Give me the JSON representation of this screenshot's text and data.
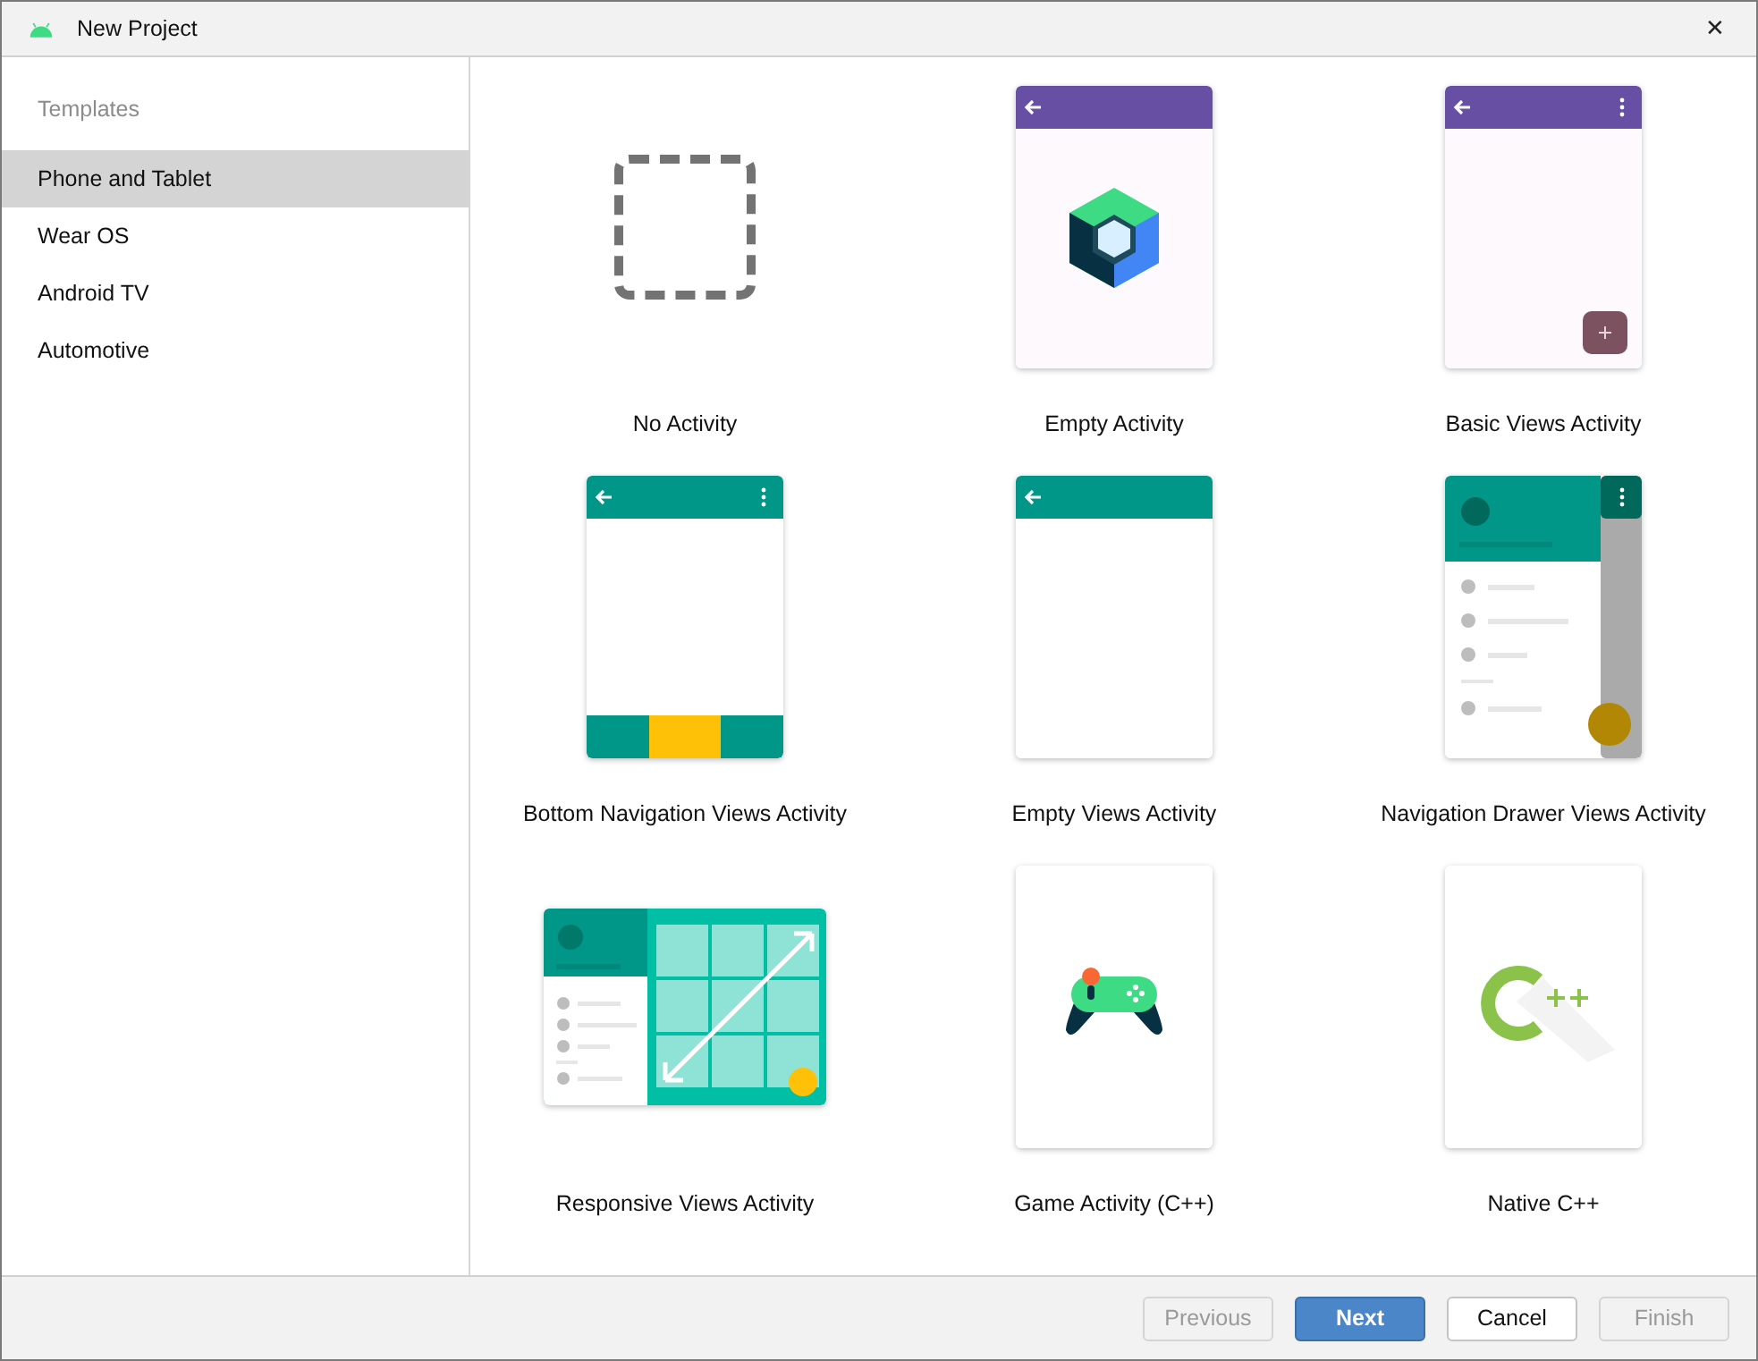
{
  "window": {
    "title": "New Project",
    "close": "✕"
  },
  "sidebar": {
    "heading": "Templates",
    "items": [
      {
        "label": "Phone and Tablet",
        "selected": true
      },
      {
        "label": "Wear OS",
        "selected": false
      },
      {
        "label": "Android TV",
        "selected": false
      },
      {
        "label": "Automotive",
        "selected": false
      }
    ]
  },
  "templates": [
    {
      "label": "No Activity",
      "kind": "none"
    },
    {
      "label": "Empty Activity",
      "kind": "compose"
    },
    {
      "label": "Basic Views Activity",
      "kind": "basic"
    },
    {
      "label": "Bottom Navigation Views Activity",
      "kind": "bottom-nav"
    },
    {
      "label": "Empty Views Activity",
      "kind": "empty-views"
    },
    {
      "label": "Navigation Drawer Views Activity",
      "kind": "nav-drawer"
    },
    {
      "label": "Responsive Views Activity",
      "kind": "responsive"
    },
    {
      "label": "Game Activity (C++)",
      "kind": "game"
    },
    {
      "label": "Native C++",
      "kind": "native"
    }
  ],
  "buttons": [
    {
      "label": "Previous",
      "kind": "normal",
      "disabled": true
    },
    {
      "label": "Next",
      "kind": "default",
      "disabled": false
    },
    {
      "label": "Cancel",
      "kind": "normal",
      "disabled": false
    },
    {
      "label": "Finish",
      "kind": "normal",
      "disabled": true
    }
  ]
}
